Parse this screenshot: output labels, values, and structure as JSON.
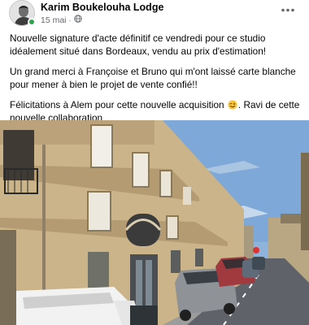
{
  "post": {
    "author": "Karim Boukelouha Lodge",
    "date": "15 mai",
    "separator": "·",
    "more_label": "•••",
    "paragraphs": [
      "Nouvelle signature d'acte définitif ce vendredi pour ce studio idéalement situé dans Bordeaux, vendu au prix d'estimation!",
      "Un grand merci à Françoise et Bruno qui m'ont laissé carte blanche pour mener à bien le projet de vente confié!!",
      "Félicitations à Alem pour cette nouvelle acquisition",
      ". Ravi de cette nouvelle collaboration"
    ],
    "icons": {
      "privacy": "globe-icon",
      "more": "more-options-icon",
      "emoji": "wink-emoji-icon",
      "status": "online-status-icon"
    },
    "colors": {
      "online": "#31a24c",
      "secondary_text": "#65676b",
      "emoji": "#f7c43a"
    }
  }
}
